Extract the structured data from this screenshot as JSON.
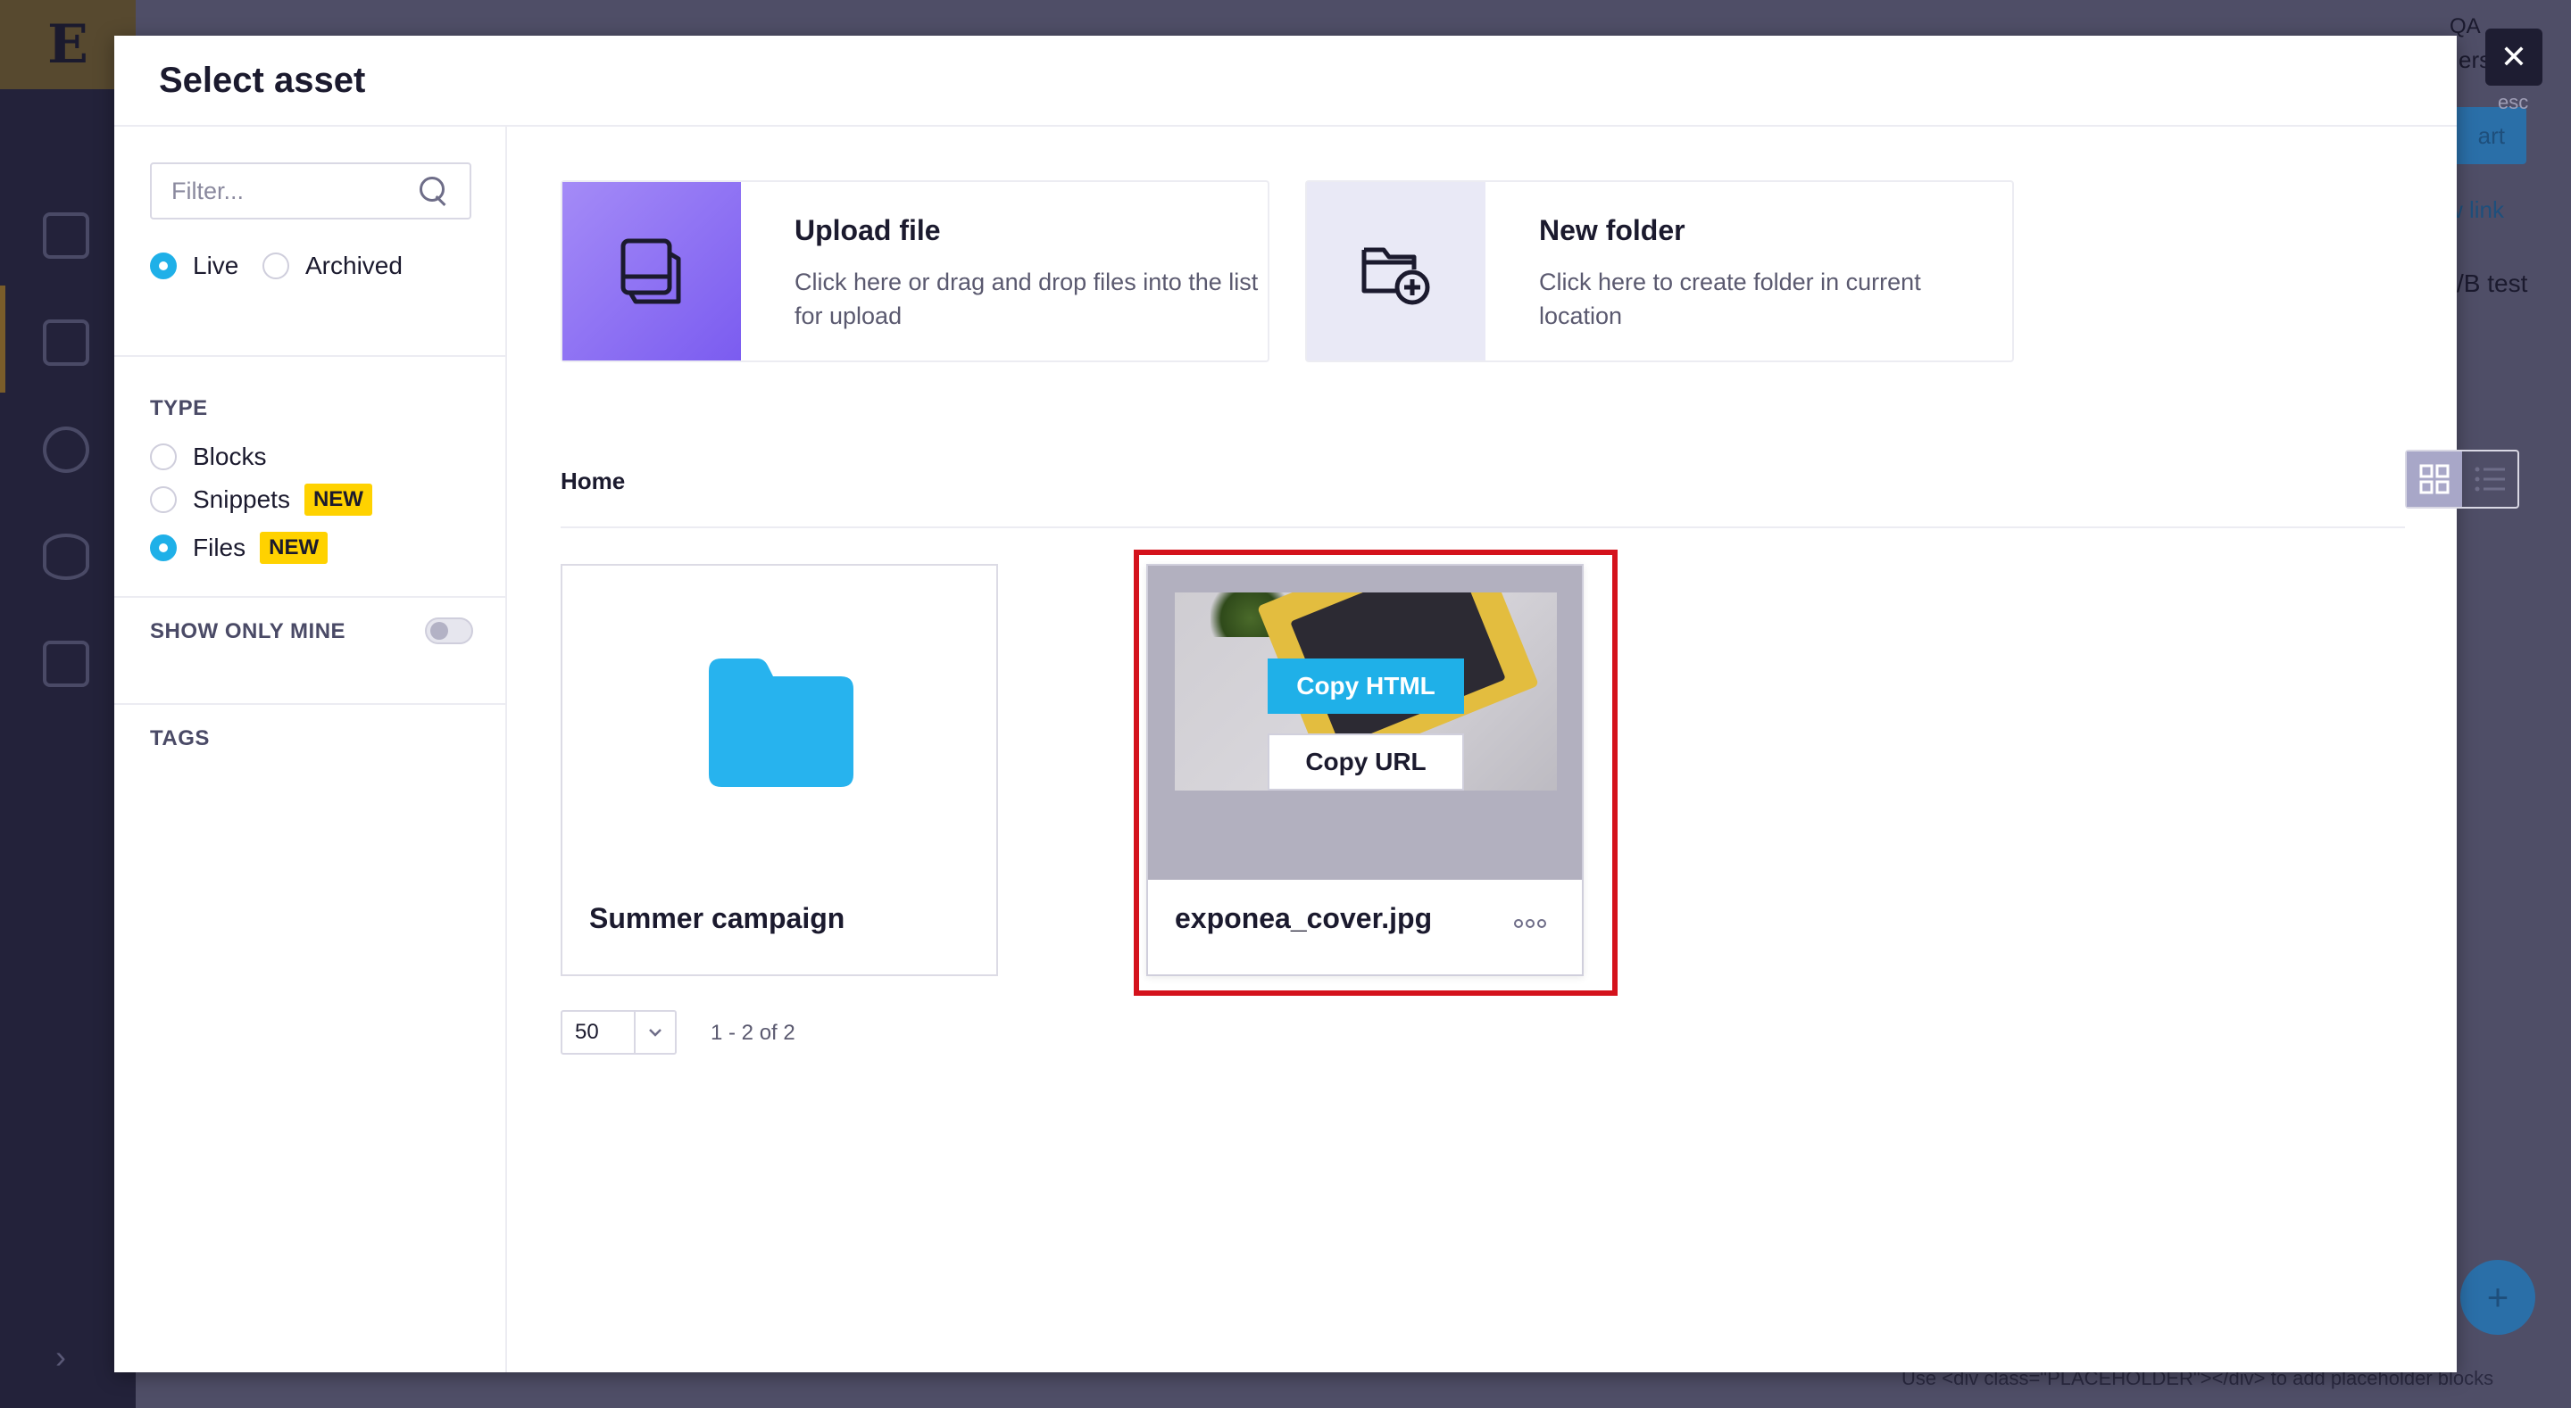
{
  "background": {
    "logo": "E",
    "text_top_right_1": "QA",
    "text_top_right_2": "ers",
    "button_fragment": "art",
    "link_fragment": "w link",
    "item_fragment": "/B test",
    "fab_symbol": "+",
    "footer_hint": "Use <div class=\"PLACEHOLDER\"></div> to add placeholder blocks",
    "close_label": "esc"
  },
  "modal": {
    "title": "Select asset"
  },
  "filters": {
    "search_placeholder": "Filter...",
    "status_options": [
      {
        "label": "Live",
        "selected": true
      },
      {
        "label": "Archived",
        "selected": false
      }
    ],
    "type_label": "TYPE",
    "type_options": [
      {
        "label": "Blocks",
        "selected": false,
        "badge": ""
      },
      {
        "label": "Snippets",
        "selected": false,
        "badge": "NEW"
      },
      {
        "label": "Files",
        "selected": true,
        "badge": "NEW"
      }
    ],
    "show_only_mine_label": "SHOW ONLY MINE",
    "show_only_mine_on": false,
    "tags_label": "TAGS"
  },
  "actions": {
    "upload": {
      "title": "Upload file",
      "description": "Click here or drag and drop files into the list for upload"
    },
    "new_folder": {
      "title": "New folder",
      "description": "Click here to create folder in current location"
    }
  },
  "breadcrumb": "Home",
  "view_mode": "grid",
  "items": [
    {
      "type": "folder",
      "name": "Summer campaign"
    },
    {
      "type": "file",
      "name": "exponea_cover.jpg",
      "copy_html_label": "Copy HTML",
      "copy_url_label": "Copy URL"
    }
  ],
  "pagination": {
    "page_size": "50",
    "range_text": "1 - 2 of 2"
  },
  "colors": {
    "accent": "#1fb0e8",
    "badge": "#ffd200",
    "highlight": "#d4121c",
    "upload_gradient_start": "#a48bf7",
    "upload_gradient_end": "#7b5cf0"
  }
}
